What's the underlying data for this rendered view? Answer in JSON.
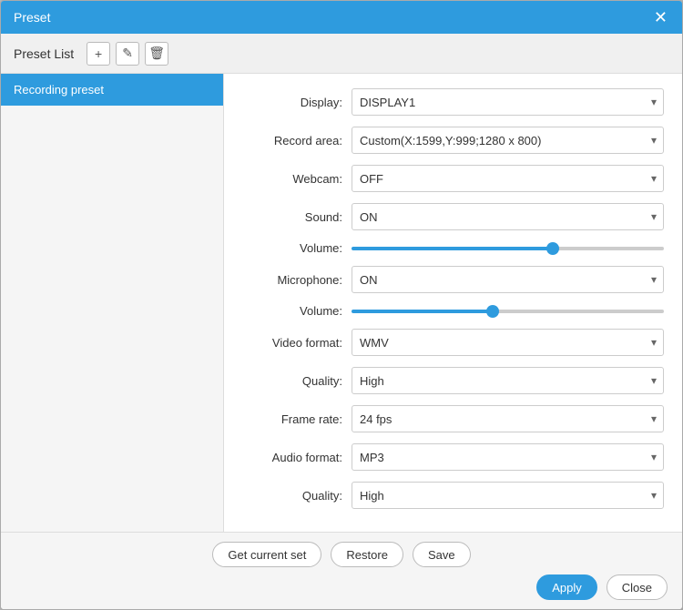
{
  "dialog": {
    "title": "Preset",
    "close_label": "✕"
  },
  "toolbar": {
    "label": "Preset List",
    "add_label": "+",
    "edit_label": "✎",
    "delete_label": "🗑"
  },
  "sidebar": {
    "items": [
      {
        "label": "Recording preset",
        "active": true
      }
    ]
  },
  "form": {
    "display_label": "Display:",
    "display_value": "DISPLAY1",
    "record_area_label": "Record area:",
    "record_area_value": "Custom(X:1599,Y:999;1280 x 800)",
    "webcam_label": "Webcam:",
    "webcam_value": "OFF",
    "sound_label": "Sound:",
    "sound_value": "ON",
    "sound_volume_label": "Volume:",
    "sound_volume": 65,
    "microphone_label": "Microphone:",
    "microphone_value": "ON",
    "mic_volume_label": "Volume:",
    "mic_volume": 45,
    "video_format_label": "Video format:",
    "video_format_value": "WMV",
    "video_quality_label": "Quality:",
    "video_quality_value": "High",
    "frame_rate_label": "Frame rate:",
    "frame_rate_value": "24 fps",
    "audio_format_label": "Audio format:",
    "audio_format_value": "MP3",
    "audio_quality_label": "Quality:",
    "audio_quality_value": "High"
  },
  "buttons": {
    "get_current_set": "Get current set",
    "restore": "Restore",
    "save": "Save",
    "apply": "Apply",
    "close": "Close"
  }
}
